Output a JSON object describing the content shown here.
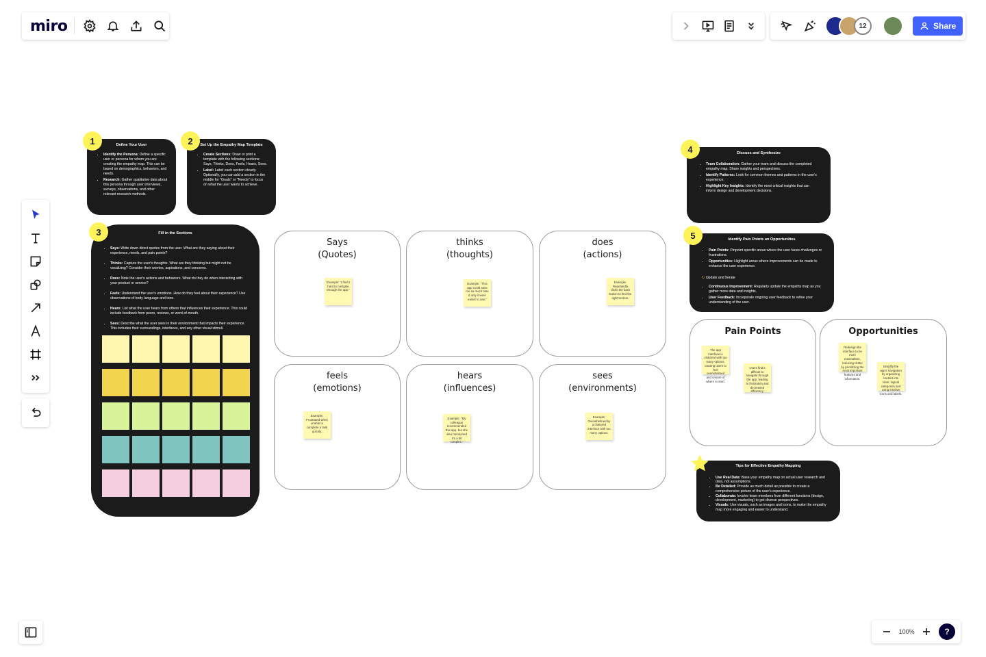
{
  "app": {
    "logo": "miro"
  },
  "topbar_right": {
    "avatar_count": "12",
    "share_label": "Share",
    "brand_color": "#4262ff"
  },
  "cards": {
    "c1": {
      "badge": "1",
      "title": "Define Your User",
      "items": [
        {
          "b": "Identify the Persona:",
          "t": " Define a specific user or persona for whom you are creating the empathy map. This can be based on demographics, behaviors, and needs."
        },
        {
          "b": "Research:",
          "t": " Gather qualitative data about this persona through user interviews, surveys, observations, and other relevant research methods."
        }
      ]
    },
    "c2": {
      "badge": "2",
      "title": "Set Up the Empathy Map Template",
      "items": [
        {
          "b": "Create Sections:",
          "t": " Draw or print a template with the following sections: Says, Thinks, Does, Feels, Hears, Sees."
        },
        {
          "b": "Label:",
          "t": " Label each section clearly. Optionally, you can add a section in the middle for \"Goals\" or \"Needs\" to focus on what the user wants to achieve."
        }
      ]
    },
    "c3": {
      "badge": "3",
      "title": "Fill in the Sections",
      "items": [
        {
          "b": "Says:",
          "t": " Write down direct quotes from the user. What are they saying about their experience, needs, and pain points?"
        },
        {
          "b": "Thinks:",
          "t": " Capture the user's thoughts. What are they thinking but might not be vocalizing? Consider their worries, aspirations, and concerns."
        },
        {
          "b": "Does:",
          "t": " Note the user's actions and behaviors. What do they do when interacting with your product or service?"
        },
        {
          "b": "Feels:",
          "t": " Understand the user's emotions. How do they feel about their experience? Use observations of body language and tone."
        },
        {
          "b": "Hears:",
          "t": " List what the user hears from others that influences their experience. This could include feedback from peers, reviews, or word-of-mouth."
        },
        {
          "b": "Sees:",
          "t": " Describe what the user sees in their environment that impacts their experience. This includes their surroundings, interfaces, and any other visual stimuli."
        }
      ]
    },
    "c4": {
      "badge": "4",
      "title": "Discuss and Synthesize",
      "items": [
        {
          "b": "Team Collaboration:",
          "t": " Gather your team and discuss the completed empathy map. Share insights and perspectives."
        },
        {
          "b": "Identify Patterns:",
          "t": " Look for common themes and patterns in the user's experience."
        },
        {
          "b": "Highlight Key Insights:",
          "t": " Identify the most critical insights that can inform design and development decisions."
        }
      ]
    },
    "c5": {
      "badge": "5",
      "title": "Identify Pain Points an Opportunities",
      "items": [
        {
          "b": "Pain Points:",
          "t": " Pinpoint specific areas where the user faces challenges or frustrations."
        },
        {
          "b": "Opportunities:",
          "t": " Highlight areas where improvements can be made to enhance the user experience."
        }
      ],
      "subhead": "Update and Iterate",
      "items2": [
        {
          "b": "Continuous Improvement:",
          "t": " Regularly update the empathy map as you gather more data and insights."
        },
        {
          "b": "User Feedback:",
          "t": " Incorporate ongoing user feedback to refine your understanding of the user."
        }
      ]
    },
    "tips": {
      "title": "Tips for Effective Empathy Mapping",
      "items": [
        {
          "b": "Use Real Data:",
          "t": " Base your empathy map on actual user research and data, not assumptions."
        },
        {
          "b": "Be Detailed:",
          "t": " Provide as much detail as possible to create a comprehensive picture of the user's experience."
        },
        {
          "b": "Collaborate:",
          "t": " Involve team members from different functions (design, development, marketing) to get diverse perspectives."
        },
        {
          "b": "Visuals:",
          "t": " Use visuals, such as images and icons, to make the empathy map more engaging and easier to understand."
        }
      ]
    }
  },
  "quadrants": {
    "says": {
      "l1": "Says",
      "l2": "(Quotes)",
      "note": "Example: \"I find it hard to navigate through the app.\""
    },
    "thinks": {
      "l1": "thinks",
      "l2": "(thoughts)",
      "note": "Example: \"This app could save me so much time if only it were easier to use.\""
    },
    "does": {
      "l1": "does",
      "l2": "(actions)",
      "note": "Example: Repeatedly clicks the back button to find the right section."
    },
    "feels": {
      "l1": "feels",
      "l2": "(emotions)",
      "note": "Example: Frustrated when unable to complete a task quickly."
    },
    "hears": {
      "l1": "hears",
      "l2": "(influences)",
      "note": "Example: \"My colleague recommended this app, but she also mentioned it's a bit complex.\""
    },
    "sees": {
      "l1": "sees",
      "l2": "(environments)",
      "note": "Example: Overwhelmed by a cluttered interface with too many options."
    }
  },
  "pain_points": {
    "title": "Pain Points",
    "note1": "The app interface is cluttered with too many options, causing users to feel overwhelmed and unsure of where to start.",
    "note2": "Users find it difficult to navigate through the app, leading to frustration and decreased efficiency."
  },
  "opportunities": {
    "title": "Opportunities",
    "note1": "Redesign the interface to be more minimalistic, reducing clutter by prioritizing the most important features and information.",
    "note2": "Simplify the app's navigation by organizing content into clear, logical categories and using intuitive icons and labels."
  },
  "zoom": {
    "level": "100%",
    "help": "?"
  },
  "colors": {
    "row1": "#fff6b0",
    "row2": "#f2d44e",
    "row3": "#d9f39a",
    "row4": "#7fc4bf",
    "row5": "#f5cfe0",
    "card_bg": "#1b1b1b",
    "badge": "#fff35a",
    "sticky": "#fff9b1"
  }
}
